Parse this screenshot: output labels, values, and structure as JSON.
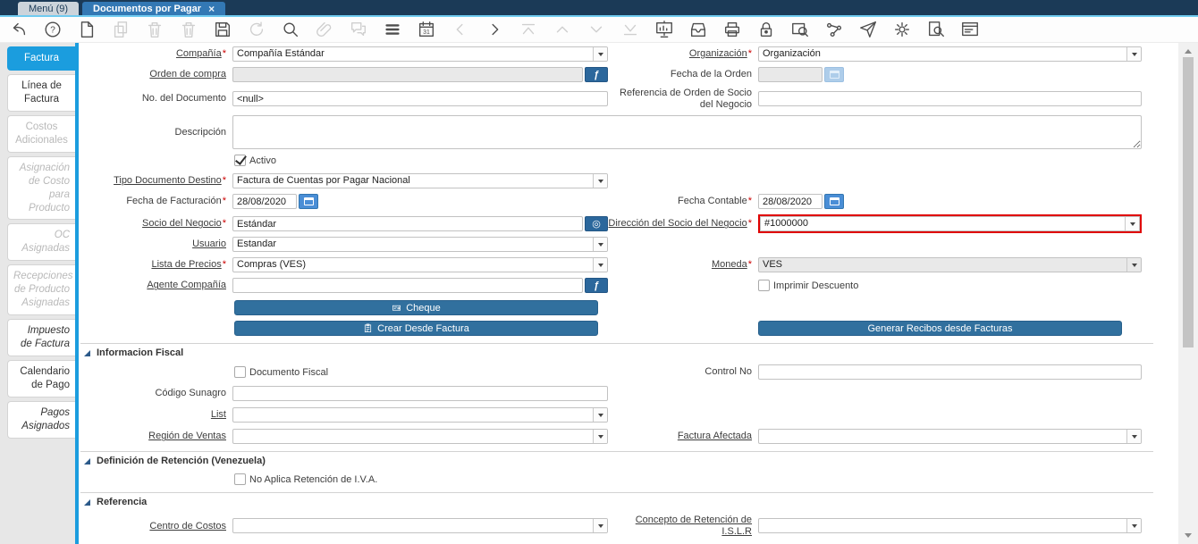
{
  "window": {
    "tabs": [
      {
        "label": "Menú (9)"
      },
      {
        "label": "Documentos por Pagar"
      }
    ],
    "close_glyph": "×"
  },
  "toolbar": {
    "icons": [
      {
        "name": "undo",
        "enabled": true
      },
      {
        "name": "help",
        "enabled": true
      },
      {
        "name": "new-record",
        "enabled": true
      },
      {
        "name": "copy-record",
        "enabled": false
      },
      {
        "name": "delete-record",
        "enabled": false
      },
      {
        "name": "delete-selection",
        "enabled": false
      },
      {
        "name": "save",
        "enabled": true
      },
      {
        "name": "refresh",
        "enabled": false
      },
      {
        "name": "find",
        "enabled": true
      },
      {
        "name": "attachment",
        "enabled": false
      },
      {
        "name": "chat",
        "enabled": false
      },
      {
        "name": "grid-toggle",
        "enabled": true
      },
      {
        "name": "calendar",
        "enabled": true
      },
      {
        "name": "parent-record",
        "enabled": false
      },
      {
        "name": "detail-record",
        "enabled": true
      },
      {
        "name": "first-record",
        "enabled": false
      },
      {
        "name": "previous-record",
        "enabled": false
      },
      {
        "name": "next-record",
        "enabled": false
      },
      {
        "name": "last-record",
        "enabled": false
      },
      {
        "name": "report",
        "enabled": true
      },
      {
        "name": "archive",
        "enabled": true
      },
      {
        "name": "print",
        "enabled": true
      },
      {
        "name": "lock",
        "enabled": true
      },
      {
        "name": "print-preview",
        "enabled": true
      },
      {
        "name": "workflow",
        "enabled": true
      },
      {
        "name": "send",
        "enabled": true
      },
      {
        "name": "preferences",
        "enabled": true
      },
      {
        "name": "product-info",
        "enabled": true
      },
      {
        "name": "form",
        "enabled": true
      }
    ]
  },
  "sidebar": {
    "tabs": [
      {
        "label": "Factura"
      },
      {
        "label": "Línea de Factura"
      },
      {
        "label": "Costos Adicionales"
      },
      {
        "label": "Asignación de Costo para Producto"
      },
      {
        "label": "OC Asignadas"
      },
      {
        "label": "Recepciones de Producto Asignadas"
      },
      {
        "label": "Impuesto de Factura"
      },
      {
        "label": "Calendario de Pago"
      },
      {
        "label": "Pagos Asignados"
      }
    ]
  },
  "form": {
    "required_marker": "*",
    "fields": {
      "compania": {
        "label": "Compañía",
        "value": "Compañía Estándar"
      },
      "organizacion": {
        "label": "Organización",
        "value": "Organización"
      },
      "orden_compra": {
        "label": "Orden de compra",
        "value": ""
      },
      "fecha_orden": {
        "label": "Fecha de la Orden",
        "value": ""
      },
      "no_documento": {
        "label": "No. del Documento",
        "value": "<null>"
      },
      "referencia_orden": {
        "label": "Referencia de Orden de Socio del Negocio",
        "value": ""
      },
      "descripcion": {
        "label": "Descripción",
        "value": ""
      },
      "activo": {
        "label": "Activo",
        "checked": true
      },
      "tipo_documento": {
        "label": "Tipo Documento Destino",
        "value": "Factura de Cuentas por Pagar Nacional"
      },
      "fecha_facturacion": {
        "label": "Fecha de Facturación",
        "value": "28/08/2020"
      },
      "fecha_contable": {
        "label": "Fecha Contable",
        "value": "28/08/2020"
      },
      "socio_negocio": {
        "label": "Socio del Negocio",
        "value": "Estándar"
      },
      "direccion_socio": {
        "label": "Dirección del Socio del Negocio",
        "value": "#1000000"
      },
      "usuario": {
        "label": "Usuario",
        "value": "Estandar"
      },
      "lista_precios": {
        "label": "Lista de Precios",
        "value": "Compras (VES)"
      },
      "moneda": {
        "label": "Moneda",
        "value": "VES"
      },
      "agente_compania": {
        "label": "Agente Compañía",
        "value": ""
      },
      "imprimir_descuento": {
        "label": "Imprimir Descuento",
        "checked": false
      },
      "documento_fiscal": {
        "label": "Documento Fiscal",
        "checked": false
      },
      "control_no": {
        "label": "Control No",
        "value": ""
      },
      "codigo_sunagro": {
        "label": "Código Sunagro",
        "value": ""
      },
      "list": {
        "label": "List",
        "value": ""
      },
      "region_ventas": {
        "label": "Región de Ventas",
        "value": ""
      },
      "factura_afectada": {
        "label": "Factura Afectada",
        "value": ""
      },
      "no_aplica_retencion": {
        "label": "No Aplica Retención de I.V.A.",
        "checked": false
      },
      "centro_costos": {
        "label": "Centro de Costos",
        "value": ""
      },
      "concepto_retencion": {
        "label": "Concepto de Retención de I.S.L.R",
        "value": ""
      }
    },
    "buttons": {
      "cheque": "Cheque",
      "crear_desde_factura": "Crear Desde Factura",
      "generar_recibos": "Generar Recibos desde Facturas"
    },
    "sections": {
      "fiscal": "Informacion Fiscal",
      "retencion": "Definición de Retención (Venezuela)",
      "referencia": "Referencia"
    },
    "icons": {
      "zoom_button_glyph": "ƒ",
      "record_button_glyph": "◎"
    }
  },
  "colors": {
    "titlebar": "#1b3a57",
    "active_window_tab": "#3378b4",
    "tab_underline": "#70cbf0",
    "sidebar_active": "#1b9dde",
    "action_button": "#31709e",
    "field_button": "#2b679c",
    "calendar_button": "#4a8ed6",
    "required": "#cc0000",
    "highlight_border": "#e00000"
  }
}
